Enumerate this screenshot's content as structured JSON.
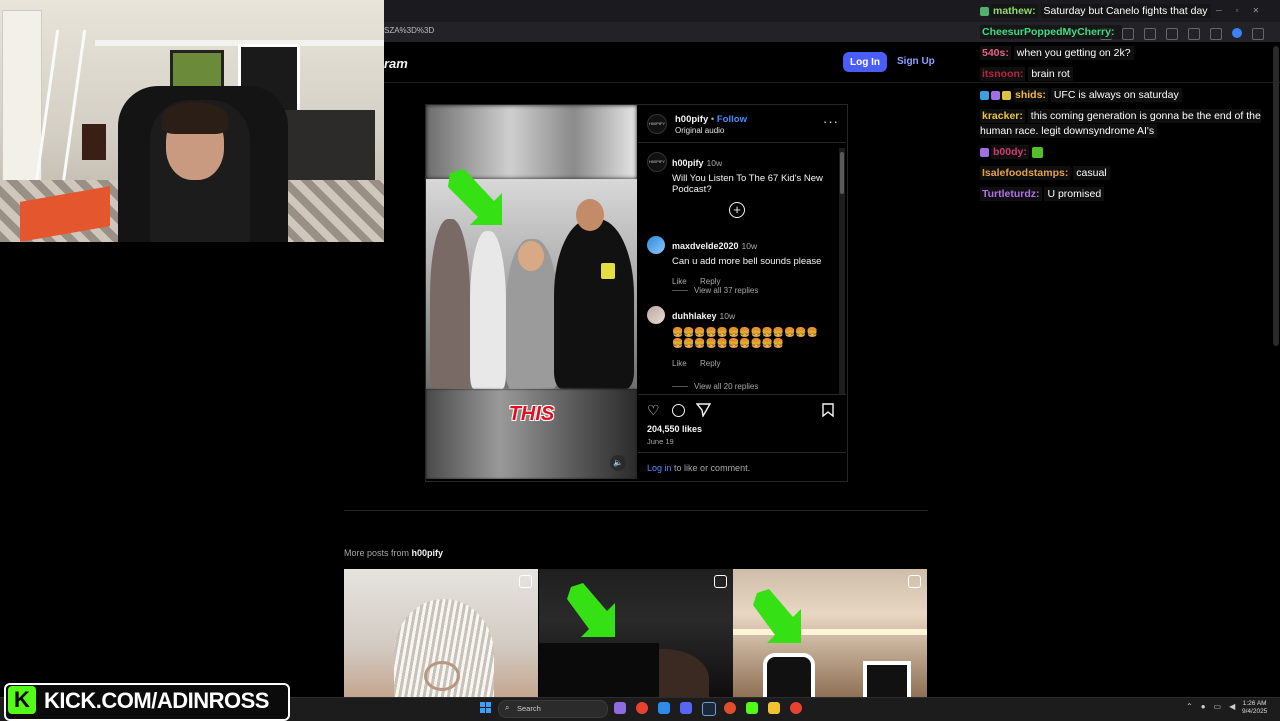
{
  "browser": {
    "url_fragment": "SZA%3D%3D"
  },
  "site_header": {
    "brand": "ram",
    "login_label": "Log In",
    "signup_label": "Sign Up"
  },
  "chat": {
    "messages": [
      {
        "user": "mathew:",
        "text": "Saturday but Canelo fights that day",
        "color": "#8fdc6a"
      },
      {
        "user": "CheesurPoppedMyCherry:",
        "text": "",
        "color": "#3ddc84"
      },
      {
        "user": "540s:",
        "text": "when you getting on 2k?",
        "color": "#e85f8a"
      },
      {
        "user": "itsnoon:",
        "text": "brain rot",
        "color": "#b8233f"
      },
      {
        "user": "shids:",
        "text": "UFC is always on saturday",
        "color": "#f2b84b"
      },
      {
        "user": "kracker:",
        "text": "this coming generation is gonna be the end of the human race. legit downsyndrome AI's",
        "color": "#eac43a"
      },
      {
        "user": "b00dy:",
        "text": "",
        "color": "#d23b6b"
      },
      {
        "user": "Isalefoodstamps:",
        "text": "casual",
        "color": "#e3a24a"
      },
      {
        "user": "Turtleturdz:",
        "text": "U promised",
        "color": "#b071e8"
      }
    ]
  },
  "post": {
    "author": "h00pify",
    "follow_label": "Follow",
    "audio": "Original audio",
    "caption_time": "10w",
    "caption": "Will You Listen To The 67 Kid's New Podcast?",
    "media_overlay_text": "THIS",
    "likes": "204,550 likes",
    "date": "June 19",
    "login_link": "Log in",
    "login_suffix": "to like or comment.",
    "comments": [
      {
        "user": "maxdvelde2020",
        "time": "10w",
        "text": "Can u add more bell sounds please",
        "like": "Like",
        "reply": "Reply",
        "view_all": "View all 37 replies"
      },
      {
        "user": "duhhlakey",
        "time": "10w",
        "text": "🍔🍔🍔🍔🍔🍔🍔🍔🍔🍔🍔🍔🍔\n🍔🍔🍔🍔🍔🍔🍔🍔🍔🍔",
        "like": "Like",
        "reply": "Reply",
        "view_all": "View all 20 replies"
      }
    ]
  },
  "more_posts": {
    "label": "More posts from",
    "author": "h00pify"
  },
  "overlay": {
    "kick_logo": "K",
    "kick_url": "KICK.COM/ADINROSS"
  },
  "taskbar": {
    "search_placeholder": "Search",
    "time": "1:26 AM",
    "date": "9/4/2025"
  }
}
